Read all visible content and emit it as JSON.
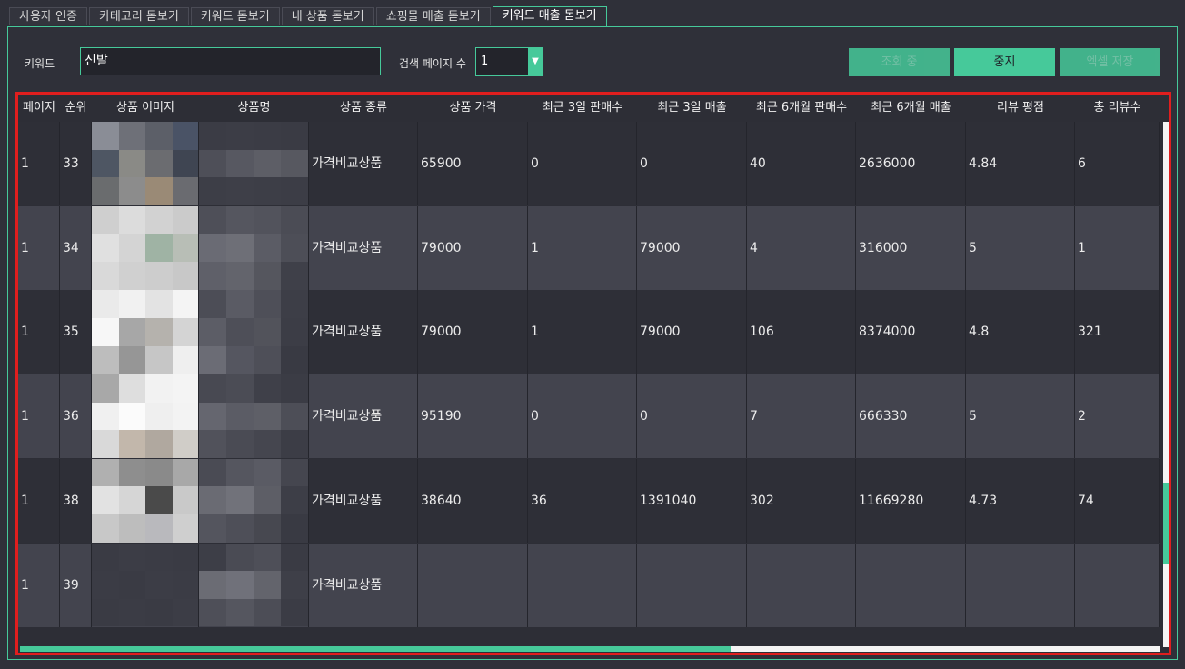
{
  "tabs": [
    "사용자 인증",
    "카테고리 돋보기",
    "키워드 돋보기",
    "내 상품 돋보기",
    "쇼핑몰 매출 돋보기",
    "키워드 매출 돋보기"
  ],
  "form": {
    "keyword_label": "키워드",
    "keyword_value": "신발",
    "pages_label": "검색 페이지 수",
    "pages_value": "1"
  },
  "buttons": {
    "query": "조회 중",
    "stop": "중지",
    "excel": "엑셀 저장"
  },
  "table": {
    "columns": [
      "페이지",
      "순위",
      "상품 이미지",
      "상품명",
      "상품 종류",
      "상품 가격",
      "최근 3일 판매수",
      "최근 3일 매출",
      "최근 6개월 판매수",
      "최근 6개월 매출",
      "리뷰 평점",
      "총 리뷰수"
    ],
    "rows": [
      {
        "page": "1",
        "rank": "33",
        "type": "가격비교상품",
        "price": "65900",
        "s3": "0",
        "r3": "0",
        "s6": "40",
        "r6": "2636000",
        "rating": "4.84",
        "reviews": "6"
      },
      {
        "page": "1",
        "rank": "34",
        "type": "가격비교상품",
        "price": "79000",
        "s3": "1",
        "r3": "79000",
        "s6": "4",
        "r6": "316000",
        "rating": "5",
        "reviews": "1"
      },
      {
        "page": "1",
        "rank": "35",
        "type": "가격비교상품",
        "price": "79000",
        "s3": "1",
        "r3": "79000",
        "s6": "106",
        "r6": "8374000",
        "rating": "4.8",
        "reviews": "321"
      },
      {
        "page": "1",
        "rank": "36",
        "type": "가격비교상품",
        "price": "95190",
        "s3": "0",
        "r3": "0",
        "s6": "7",
        "r6": "666330",
        "rating": "5",
        "reviews": "2"
      },
      {
        "page": "1",
        "rank": "38",
        "type": "가격비교상품",
        "price": "38640",
        "s3": "36",
        "r3": "1391040",
        "s6": "302",
        "r6": "11669280",
        "rating": "4.73",
        "reviews": "74"
      },
      {
        "page": "1",
        "rank": "39",
        "type": "가격비교상품",
        "price": "",
        "s3": "",
        "r3": "",
        "s6": "",
        "r6": "",
        "rating": "",
        "reviews": ""
      }
    ]
  },
  "colors": {
    "accent": "#46c99a",
    "highlight": "#e01e1e",
    "background": "#2f3039"
  }
}
